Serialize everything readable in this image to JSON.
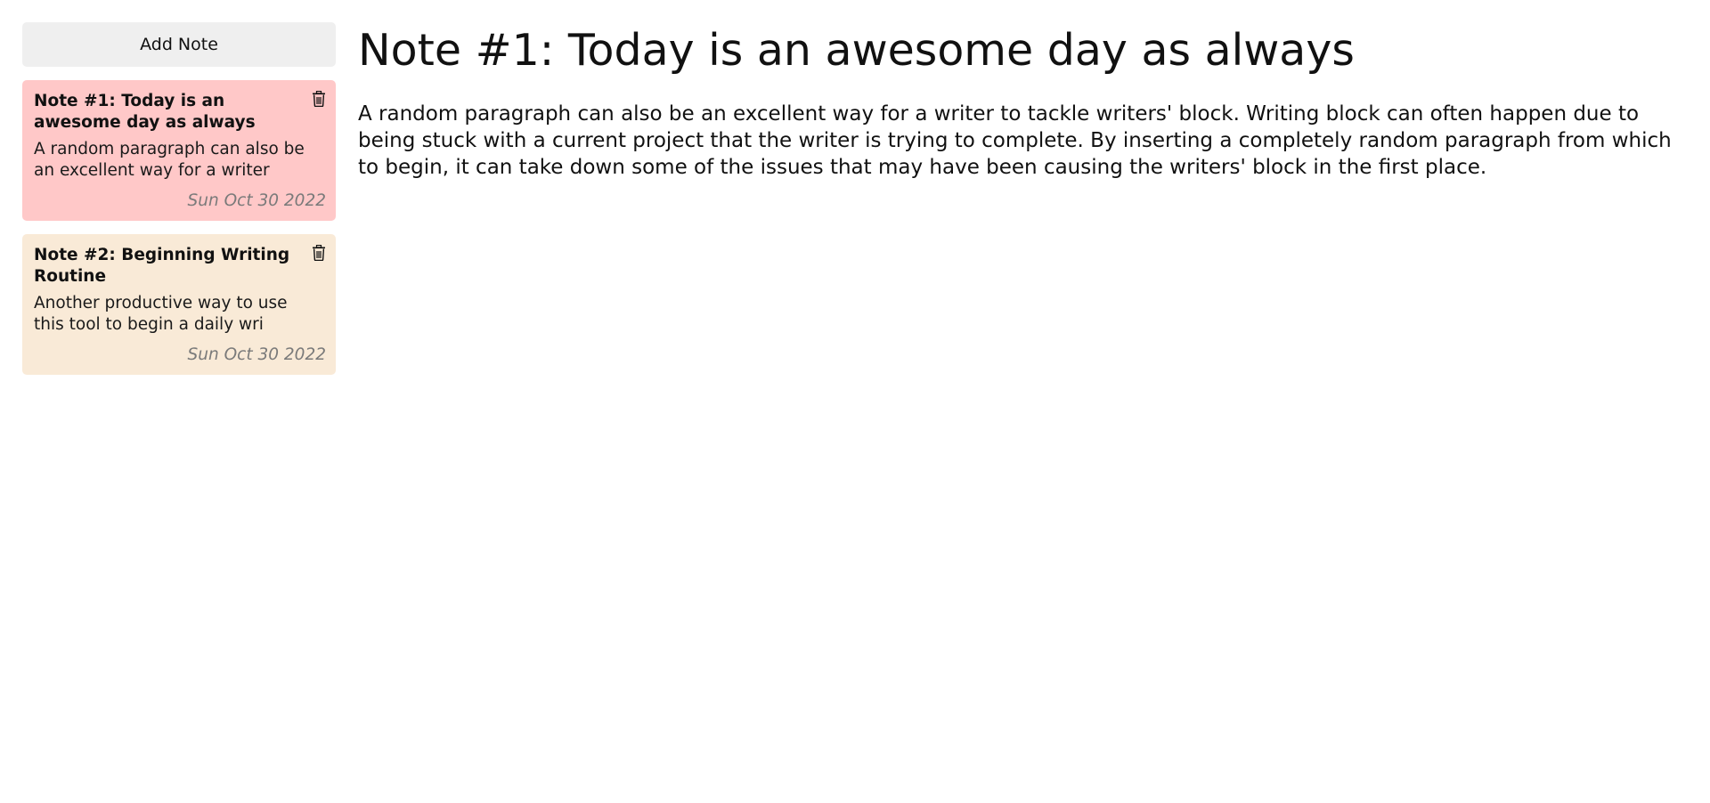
{
  "sidebar": {
    "add_note_label": "Add Note",
    "notes": [
      {
        "title": "Note #1: Today is an awesome day as always",
        "preview": "A random paragraph can also be an excellent way for a writer",
        "date": "Sun Oct 30 2022",
        "active": true,
        "color": "#ffc8c8"
      },
      {
        "title": "Note #2: Beginning Writing Routine",
        "preview": "Another productive way to use this tool to begin a daily wri",
        "date": "Sun Oct 30 2022",
        "active": false,
        "color": "#f9ead7"
      }
    ],
    "delete_icon": "trash-icon"
  },
  "main": {
    "title": "Note #1: Today is an awesome day as always",
    "body": "A random paragraph can also be an excellent way for a writer to tackle writers' block. Writing block can often happen due to being stuck with a current project that the writer is trying to complete. By inserting a completely random paragraph from which to begin, it can take down some of the issues that may have been causing the writers' block in the first place."
  }
}
